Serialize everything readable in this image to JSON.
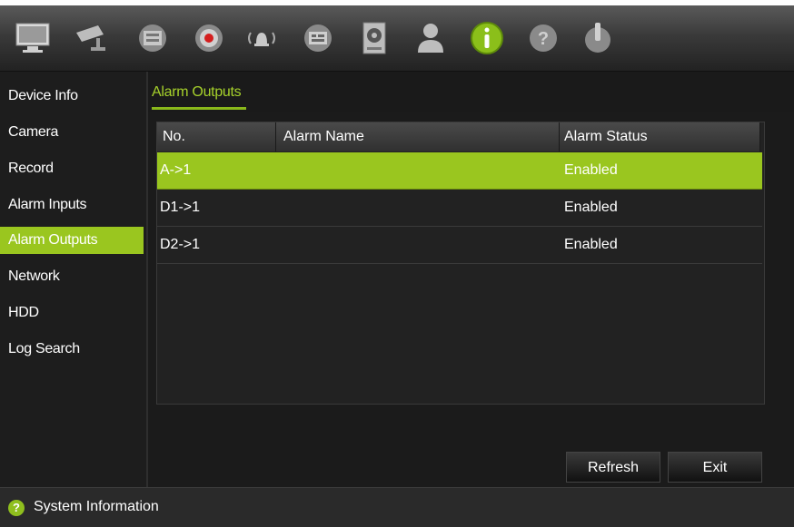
{
  "toolbar": {
    "icons": [
      "display-icon",
      "camera-icon",
      "record-icon",
      "record-dot-icon",
      "alarm-icon",
      "network-icon",
      "hdd-icon",
      "user-icon",
      "info-icon",
      "help-icon",
      "power-icon"
    ]
  },
  "sidebar": {
    "items": [
      {
        "label": "Device Info"
      },
      {
        "label": "Camera"
      },
      {
        "label": "Record"
      },
      {
        "label": "Alarm Inputs"
      },
      {
        "label": "Alarm Outputs",
        "active": true
      },
      {
        "label": "Network"
      },
      {
        "label": "HDD"
      },
      {
        "label": "Log Search"
      }
    ]
  },
  "main": {
    "tab": "Alarm Outputs",
    "table": {
      "columns": [
        "No.",
        "Alarm Name",
        "Alarm Status"
      ],
      "rows": [
        {
          "no": "A->1",
          "name": "",
          "status": "Enabled",
          "selected": true
        },
        {
          "no": "D1->1",
          "name": "",
          "status": "Enabled"
        },
        {
          "no": "D2->1",
          "name": "",
          "status": "Enabled"
        }
      ]
    },
    "buttons": {
      "refresh": "Refresh",
      "exit": "Exit"
    }
  },
  "status": {
    "text": "System Information",
    "icon": "help-icon"
  },
  "colors": {
    "accent": "#9ac61f",
    "background": "#1b1b1b"
  }
}
